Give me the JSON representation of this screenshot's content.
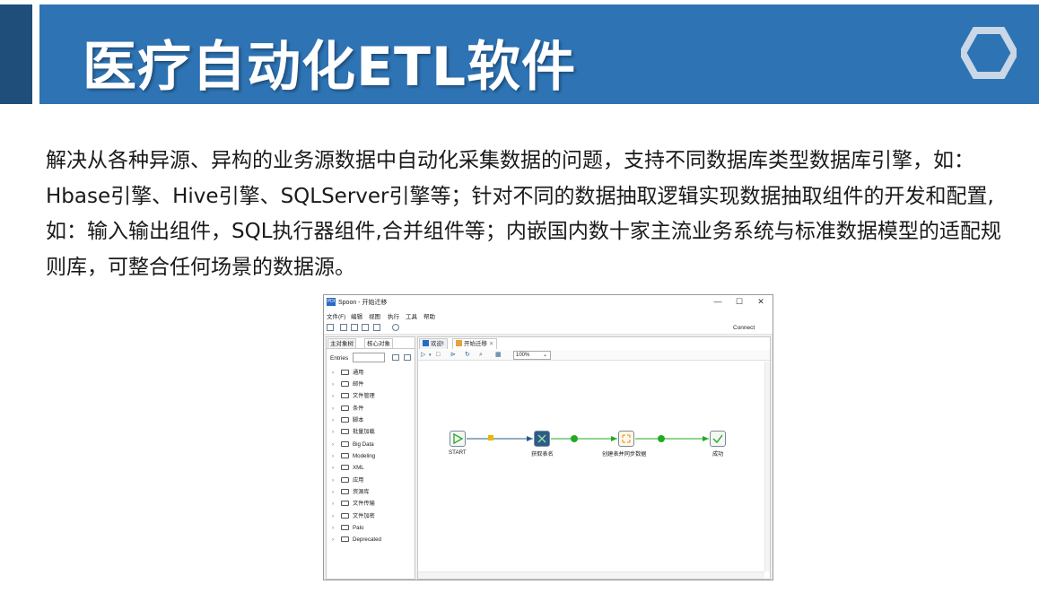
{
  "slide": {
    "title": "医疗自动化ETL软件",
    "body": "解决从各种异源、异构的业务源数据中自动化采集数据的问题，支持不同数据库类型数据库引擎，如：Hbase引擎、Hive引擎、SQLServer引擎等；针对不同的数据抽取逻辑实现数据抽取组件的开发和配置,如：输入输出组件，SQL执行器组件,合并组件等；内嵌国内数十家主流业务系统与标准数据模型的适配规则库，可整合任何场景的数据源。"
  },
  "window": {
    "title": "Spoon - 开始迁移",
    "app_icon_text": "PDI",
    "controls": {
      "minimize": "—",
      "maximize": "☐",
      "close": "✕"
    },
    "menu": [
      "文件(F)",
      "编辑",
      "视图",
      "执行",
      "工具",
      "帮助"
    ],
    "connect": "Connect"
  },
  "left_panel": {
    "tabs": [
      "主对象树",
      "核心对象"
    ],
    "entries_label": "Entries",
    "items": [
      "通用",
      "邮件",
      "文件管理",
      "条件",
      "脚本",
      "批量加载",
      "Big Data",
      "Modeling",
      "XML",
      "应用",
      "资源库",
      "文件传输",
      "文件加密",
      "Palo",
      "Deprecated"
    ]
  },
  "right_panel": {
    "tabs": [
      "欢迎!",
      "开始迁移"
    ],
    "tab_close": "✕",
    "zoom": "100%"
  },
  "workflow": {
    "steps": [
      {
        "label": "START",
        "icon": "play-icon"
      },
      {
        "label": "获取表名",
        "icon": "table-icon"
      },
      {
        "label": "创建表并同步数据",
        "icon": "transform-icon"
      },
      {
        "label": "成功",
        "icon": "check-icon"
      }
    ]
  },
  "colors": {
    "header_band": "#2e74b5",
    "left_accent": "#1f4e7a",
    "hop_green": "#22aa22",
    "hop_blue": "#2b5c8a",
    "lock_yellow": "#e6b800"
  }
}
